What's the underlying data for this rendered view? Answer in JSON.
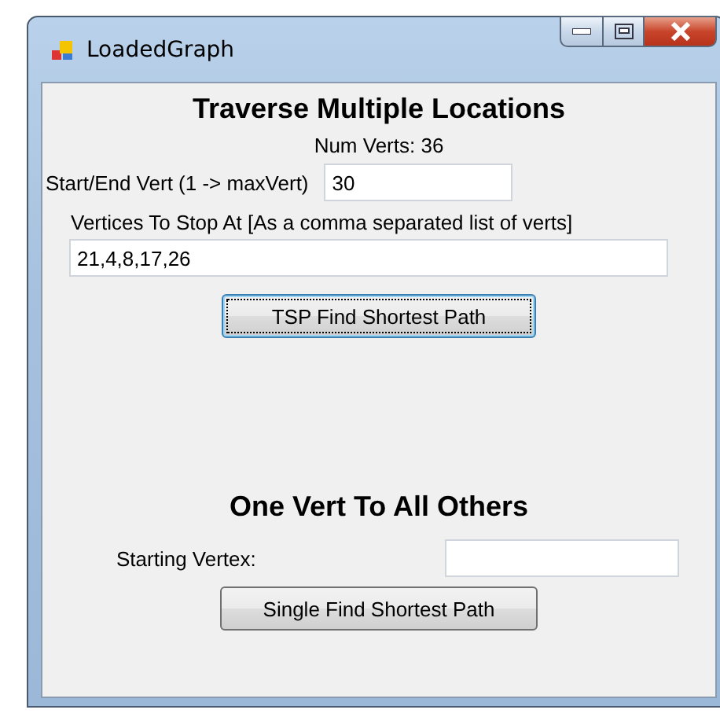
{
  "window": {
    "title": "LoadedGraph"
  },
  "traverse_section": {
    "heading": "Traverse Multiple Locations",
    "num_verts": "Num Verts: 36",
    "start_end": {
      "label": "Start/End Vert (1 -> maxVert)",
      "value": "30"
    },
    "stops": {
      "label": "Vertices To Stop At [As a comma separated list of verts]",
      "value": "21,4,8,17,26"
    },
    "button": {
      "label": "TSP Find Shortest Path",
      "focused": true
    }
  },
  "single_section": {
    "heading": "One Vert To All Others",
    "starting_vertex": {
      "label": "Starting Vertex:"
    },
    "button": {
      "label": "Single Find Shortest Path",
      "focused": false
    }
  }
}
